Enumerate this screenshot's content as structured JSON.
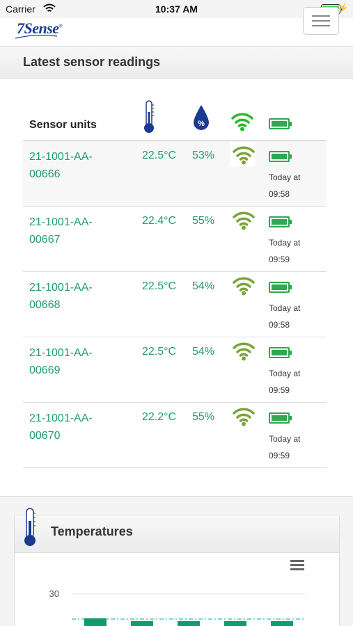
{
  "status_bar": {
    "carrier": "Carrier",
    "time": "10:37 AM"
  },
  "app": {
    "logo_text": "7Sense",
    "logo_mark": "®"
  },
  "readings": {
    "title": "Latest sensor readings",
    "column_sensor_units": "Sensor units",
    "rows": [
      {
        "id_line1": "21-1001-AA-",
        "id_line2": "00666",
        "temp": "22.5°C",
        "humidity": "53%",
        "time_line1": "Today at",
        "time_line2": "09:58"
      },
      {
        "id_line1": "21-1001-AA-",
        "id_line2": "00667",
        "temp": "22.4°C",
        "humidity": "55%",
        "time_line1": "Today at",
        "time_line2": "09:59"
      },
      {
        "id_line1": "21-1001-AA-",
        "id_line2": "00668",
        "temp": "22.5°C",
        "humidity": "54%",
        "time_line1": "Today at",
        "time_line2": "09:58"
      },
      {
        "id_line1": "21-1001-AA-",
        "id_line2": "00669",
        "temp": "22.5°C",
        "humidity": "54%",
        "time_line1": "Today at",
        "time_line2": "09:59"
      },
      {
        "id_line1": "21-1001-AA-",
        "id_line2": "00670",
        "temp": "22.2°C",
        "humidity": "55%",
        "time_line1": "Today at",
        "time_line2": "09:59"
      }
    ]
  },
  "temperatures": {
    "title": "Temperatures",
    "chart_data": {
      "type": "bar",
      "y_ticks": [
        "30"
      ],
      "bar_count": 5
    }
  },
  "colors": {
    "accent_green": "#1f9d6a",
    "signal_green": "#7aa33a",
    "battery_green": "#2fa84f",
    "brand_blue": "#1b3a8f"
  },
  "icons": {
    "header_temperature": "thermometer-icon",
    "header_humidity": "humidity-drop-icon",
    "header_signal": "signal-icon",
    "header_battery": "battery-icon"
  }
}
